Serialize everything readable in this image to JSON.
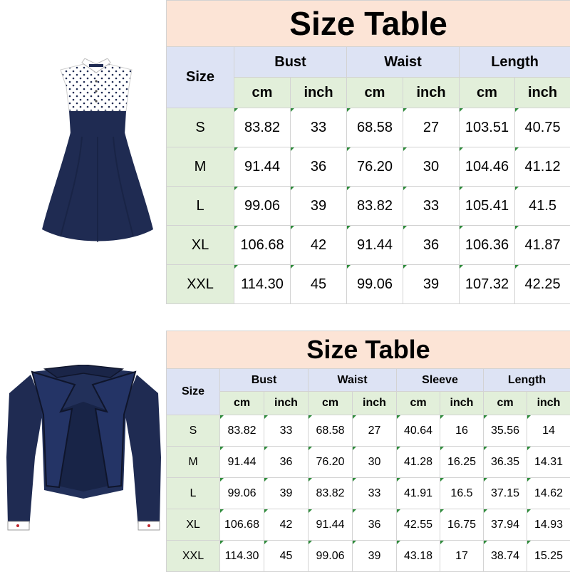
{
  "colors": {
    "title_bg": "#fce4d6",
    "header_bg": "#dde3f4",
    "subheader_bg": "#e2efda",
    "navy_fabric": "#1f2b52",
    "cell_marker": "#2e8b3b"
  },
  "icons": {
    "dress": "polka-dot-sleeveless-dress-image",
    "jacket": "navy-cropped-jacket-image"
  },
  "dress_table": {
    "title": "Size Table",
    "size_label": "Size",
    "groups": [
      "Bust",
      "Waist",
      "Length"
    ],
    "units": [
      "cm",
      "inch",
      "cm",
      "inch",
      "cm",
      "inch"
    ],
    "rows": [
      {
        "size": "S",
        "values": [
          "83.82",
          "33",
          "68.58",
          "27",
          "103.51",
          "40.75"
        ]
      },
      {
        "size": "M",
        "values": [
          "91.44",
          "36",
          "76.20",
          "30",
          "104.46",
          "41.12"
        ]
      },
      {
        "size": "L",
        "values": [
          "99.06",
          "39",
          "83.82",
          "33",
          "105.41",
          "41.5"
        ]
      },
      {
        "size": "XL",
        "values": [
          "106.68",
          "42",
          "91.44",
          "36",
          "106.36",
          "41.87"
        ]
      },
      {
        "size": "XXL",
        "values": [
          "114.30",
          "45",
          "99.06",
          "39",
          "107.32",
          "42.25"
        ]
      }
    ]
  },
  "jacket_table": {
    "title": "Size Table",
    "size_label": "Size",
    "groups": [
      "Bust",
      "Waist",
      "Sleeve",
      "Length"
    ],
    "units": [
      "cm",
      "inch",
      "cm",
      "inch",
      "cm",
      "inch",
      "cm",
      "inch"
    ],
    "rows": [
      {
        "size": "S",
        "values": [
          "83.82",
          "33",
          "68.58",
          "27",
          "40.64",
          "16",
          "35.56",
          "14"
        ]
      },
      {
        "size": "M",
        "values": [
          "91.44",
          "36",
          "76.20",
          "30",
          "41.28",
          "16.25",
          "36.35",
          "14.31"
        ]
      },
      {
        "size": "L",
        "values": [
          "99.06",
          "39",
          "83.82",
          "33",
          "41.91",
          "16.5",
          "37.15",
          "14.62"
        ]
      },
      {
        "size": "XL",
        "values": [
          "106.68",
          "42",
          "91.44",
          "36",
          "42.55",
          "16.75",
          "37.94",
          "14.93"
        ]
      },
      {
        "size": "XXL",
        "values": [
          "114.30",
          "45",
          "99.06",
          "39",
          "43.18",
          "17",
          "38.74",
          "15.25"
        ]
      }
    ]
  }
}
